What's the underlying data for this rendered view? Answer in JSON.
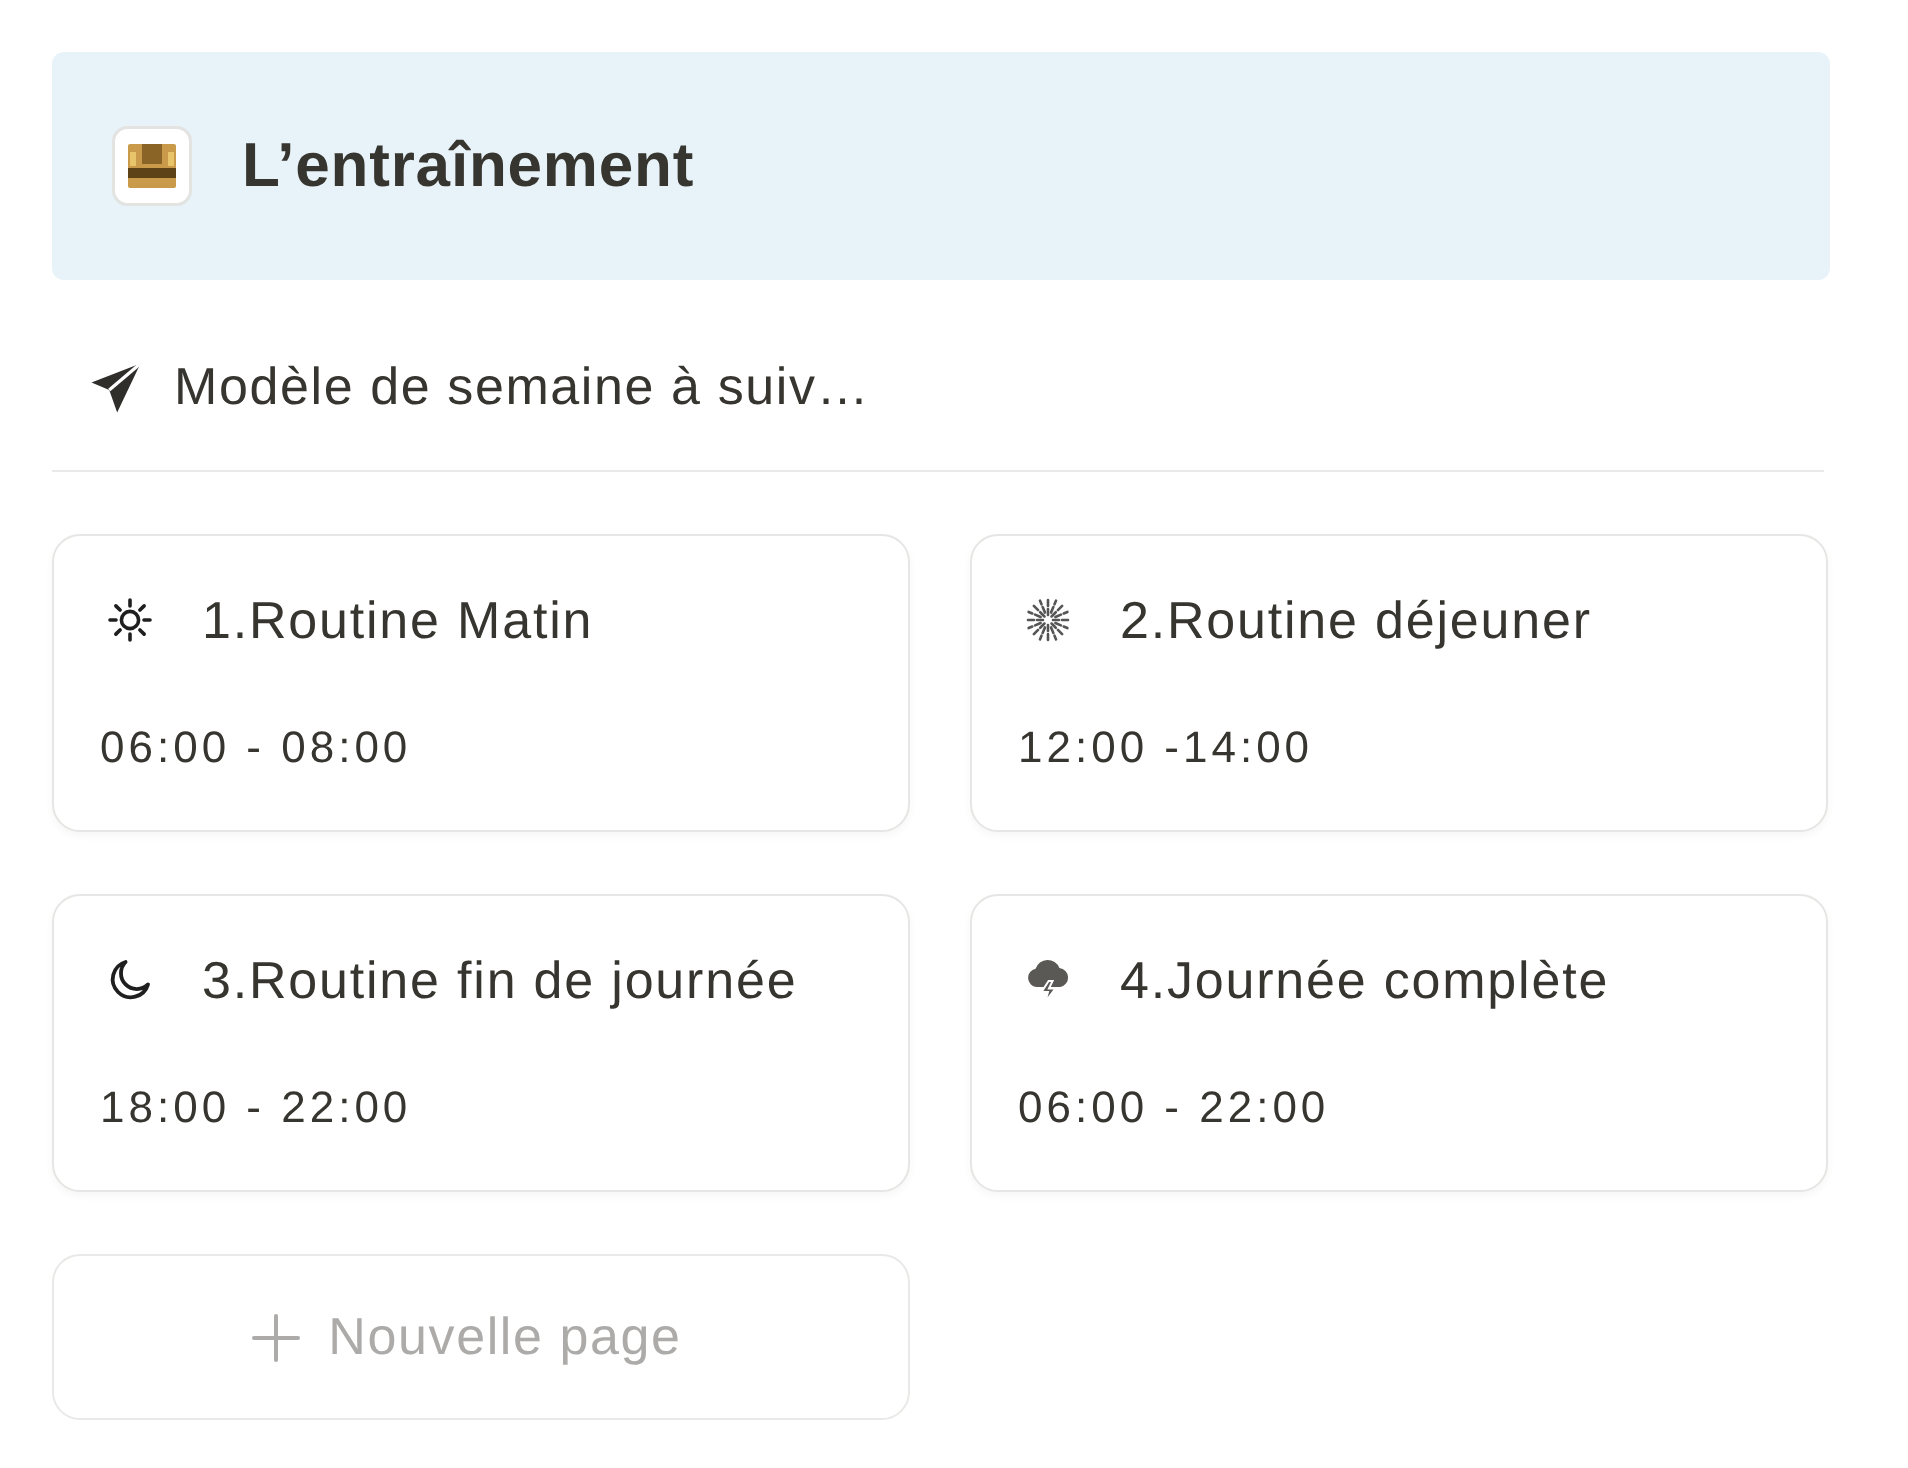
{
  "callout": {
    "title": "L’entraînement"
  },
  "view_tab": {
    "label": "Modèle de semaine à suiv…"
  },
  "cards": [
    {
      "kind": "sun",
      "title": "1.Routine Matin",
      "time": "06:00 - 08:00"
    },
    {
      "kind": "burst",
      "title": "2.Routine déjeuner",
      "time": "12:00 -14:00"
    },
    {
      "kind": "moon",
      "title": "3.Routine fin de journée",
      "time": "18:00 - 22:00"
    },
    {
      "kind": "storm",
      "title": "4.Journée complète",
      "time": "06:00 - 22:00"
    }
  ],
  "new_page": {
    "label": "Nouvelle page"
  }
}
